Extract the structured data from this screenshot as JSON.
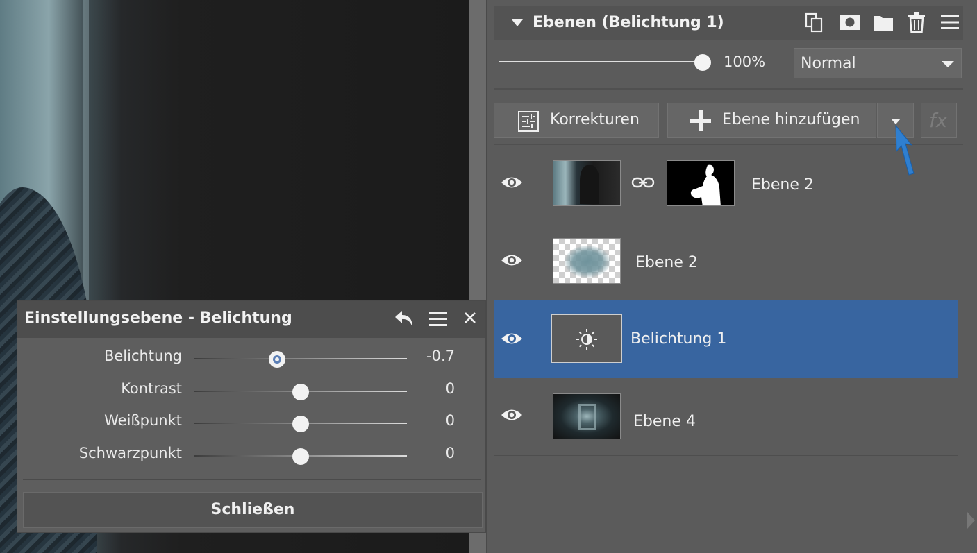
{
  "panel": {
    "title": "Ebenen (Belichtung 1)",
    "header_icons": [
      "duplicate-icon",
      "mask-icon",
      "folder-icon",
      "trash-icon",
      "menu-icon"
    ],
    "opacity": "100%",
    "opacity_level": 1.0,
    "blend_mode": "Normal",
    "korrekturen_label": "Korrekturen",
    "add_layer_label": "Ebene hinzufügen",
    "fx_label": "fx",
    "layers": [
      {
        "name": "Ebene 2",
        "has_mask": true,
        "selected": false
      },
      {
        "name": "Ebene 2",
        "has_mask": false,
        "selected": false
      },
      {
        "name": "Belichtung 1",
        "has_mask": false,
        "selected": true
      },
      {
        "name": "Ebene 4",
        "has_mask": false,
        "selected": false
      }
    ]
  },
  "dialog": {
    "title": "Einstellungsebene - Belichtung",
    "sliders": [
      {
        "label": "Belichtung",
        "value": "-0.7",
        "level": 0.39
      },
      {
        "label": "Kontrast",
        "value": "0",
        "level": 0.5
      },
      {
        "label": "Weißpunkt",
        "value": "0",
        "level": 0.5
      },
      {
        "label": "Schwarzpunkt",
        "value": "0",
        "level": 0.5
      }
    ],
    "close_label": "Schließen"
  },
  "colors": {
    "selection": "#3865a0",
    "panel_bg": "#5b5b5b",
    "cursor_arrow": "#2f7fd0"
  }
}
